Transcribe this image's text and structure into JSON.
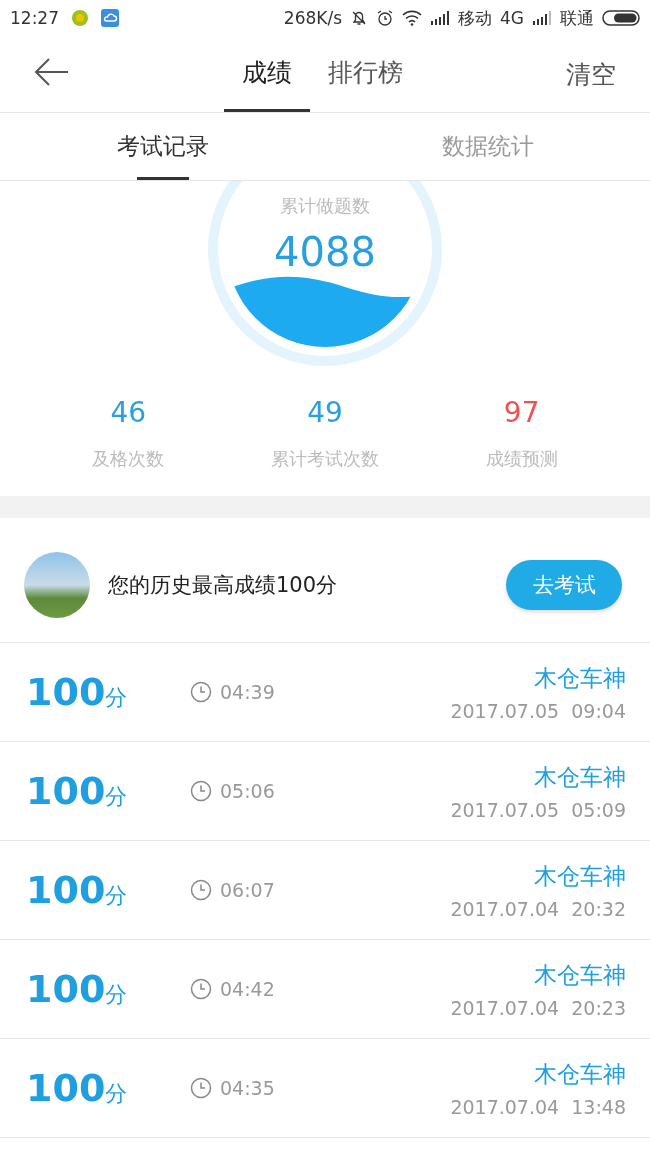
{
  "status_bar": {
    "time": "12:27",
    "speed": "268K/s",
    "carrier_1": "移动",
    "network": "4G",
    "carrier_2": "联通"
  },
  "header": {
    "tabs": [
      {
        "label": "成绩",
        "selected": true
      },
      {
        "label": "排行榜",
        "selected": false
      }
    ],
    "action": "清空"
  },
  "sub_tabs": [
    {
      "label": "考试记录",
      "selected": true
    },
    {
      "label": "数据统计",
      "selected": false
    }
  ],
  "gauge": {
    "label": "累计做题数",
    "value": "4088"
  },
  "stats": [
    {
      "value": "46",
      "label": "及格次数",
      "color": "#2a9fe0"
    },
    {
      "value": "49",
      "label": "累计考试次数",
      "color": "#2a9fe0"
    },
    {
      "value": "97",
      "label": "成绩预测",
      "color": "#ef5350"
    }
  ],
  "best": {
    "text": "您的历史最高成绩100分",
    "button": "去考试"
  },
  "records": [
    {
      "score": "100",
      "unit": "分",
      "duration": "04:39",
      "name": "木仓车神",
      "date": "2017.07.05  09:04"
    },
    {
      "score": "100",
      "unit": "分",
      "duration": "05:06",
      "name": "木仓车神",
      "date": "2017.07.05  05:09"
    },
    {
      "score": "100",
      "unit": "分",
      "duration": "06:07",
      "name": "木仓车神",
      "date": "2017.07.04  20:32"
    },
    {
      "score": "100",
      "unit": "分",
      "duration": "04:42",
      "name": "木仓车神",
      "date": "2017.07.04  20:23"
    },
    {
      "score": "100",
      "unit": "分",
      "duration": "04:35",
      "name": "木仓车神",
      "date": "2017.07.04  13:48"
    }
  ]
}
